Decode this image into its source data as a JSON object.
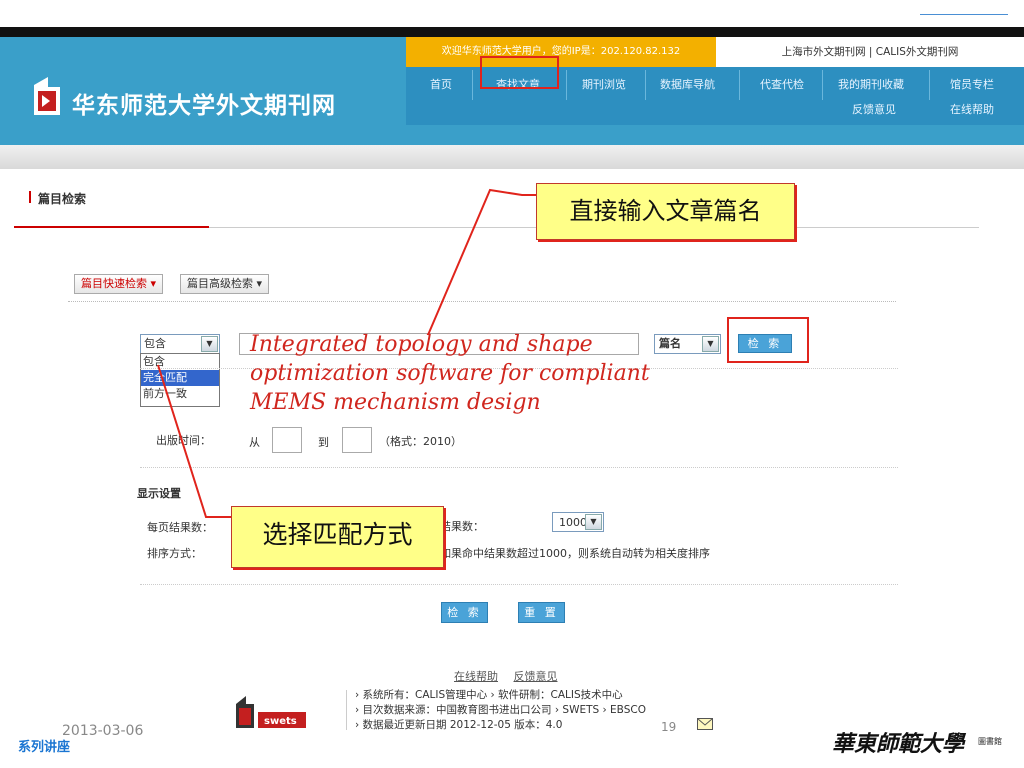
{
  "header": {
    "site_title": "华东师范大学外文期刊网",
    "welcome_text": "欢迎华东师范大学用户，您的IP是：202.120.82.132",
    "top_links": "上海市外文期刊网 | CALIS外文期刊网",
    "nav": [
      "首页",
      "查找文章",
      "期刊浏览",
      "数据库导航",
      "代查代检",
      "我的期刊收藏",
      "馆员专栏"
    ],
    "nav_row2": [
      "反馈意见",
      "在线帮助"
    ]
  },
  "section": {
    "title": "篇目检索",
    "tabs": [
      "篇目快速检索",
      "篇目高级检索"
    ]
  },
  "form": {
    "match_selected": "包含",
    "match_options": [
      "包含",
      "完全匹配",
      "前方一致"
    ],
    "query_text": "Integrated topology and shape optimization software for compliant MEMS mechanism design",
    "field_selected": "篇名",
    "search_label": "检 索",
    "pub_time_label": "出版时间：",
    "from_label": "从",
    "to_label": "到",
    "format_hint": "（格式：2010）",
    "display_title": "显示设置",
    "per_page_label": "每页结果数：",
    "sort_label": "排序方式：",
    "result_count_label": "结果数：",
    "result_count_value": "1000",
    "sort_note": "如果命中结果数超过1000，则系统自动转为相关度排序",
    "submit_label": "检 索",
    "reset_label": "重 置"
  },
  "callouts": {
    "enter_title": "直接输入文章篇名",
    "choose_match": "选择匹配方式"
  },
  "footer": {
    "help_links": [
      "在线帮助",
      "反馈意见"
    ],
    "line1": "› 系统所有：CALIS管理中心 › 软件研制：CALIS技术中心",
    "line2": "› 目次数据来源：中国教育图书进出口公司 › SWETS › EBSCO",
    "line3": "› 数据最近更新日期 2012-12-05    版本：4.0",
    "logo_text": "swets",
    "page_number": "19",
    "slide_date": "2013-03-06",
    "series_label": "系列讲座",
    "library_logo": "華東師範大學",
    "library_small": "圖書館"
  },
  "colors": {
    "header_blue": "#3a9fc9",
    "welcome_orange": "#f3b000",
    "highlight_red": "#e0241c",
    "callout_yellow": "#ffff88"
  }
}
